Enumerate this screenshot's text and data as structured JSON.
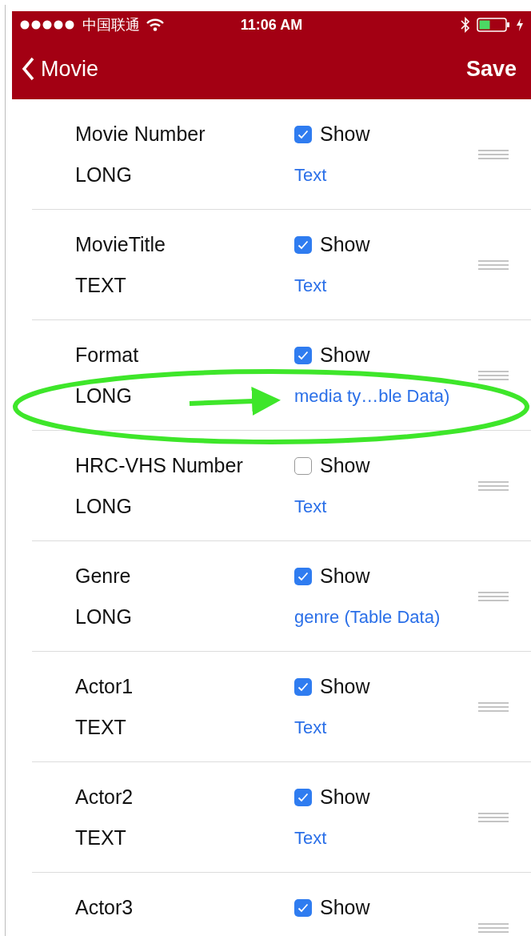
{
  "status_bar": {
    "carrier": "中国联通",
    "time": "11:06 AM"
  },
  "nav_bar": {
    "back_label": "Movie",
    "action": "Save"
  },
  "fields": [
    {
      "name": "Movie Number",
      "type": "LONG",
      "show_label": "Show",
      "checked": true,
      "format": "Text",
      "highlighted": false
    },
    {
      "name": "MovieTitle",
      "type": "TEXT",
      "show_label": "Show",
      "checked": true,
      "format": "Text",
      "highlighted": false
    },
    {
      "name": "Format",
      "type": "LONG",
      "show_label": "Show",
      "checked": true,
      "format": "media ty…ble Data)",
      "highlighted": true
    },
    {
      "name": "HRC-VHS Number",
      "type": "LONG",
      "show_label": "Show",
      "checked": false,
      "format": "Text",
      "highlighted": false
    },
    {
      "name": "Genre",
      "type": "LONG",
      "show_label": "Show",
      "checked": true,
      "format": "genre (Table Data)",
      "highlighted": false
    },
    {
      "name": "Actor1",
      "type": "TEXT",
      "show_label": "Show",
      "checked": true,
      "format": "Text",
      "highlighted": false
    },
    {
      "name": "Actor2",
      "type": "TEXT",
      "show_label": "Show",
      "checked": true,
      "format": "Text",
      "highlighted": false
    },
    {
      "name": "Actor3",
      "show_label": "Show",
      "checked": true,
      "highlighted": false
    }
  ]
}
